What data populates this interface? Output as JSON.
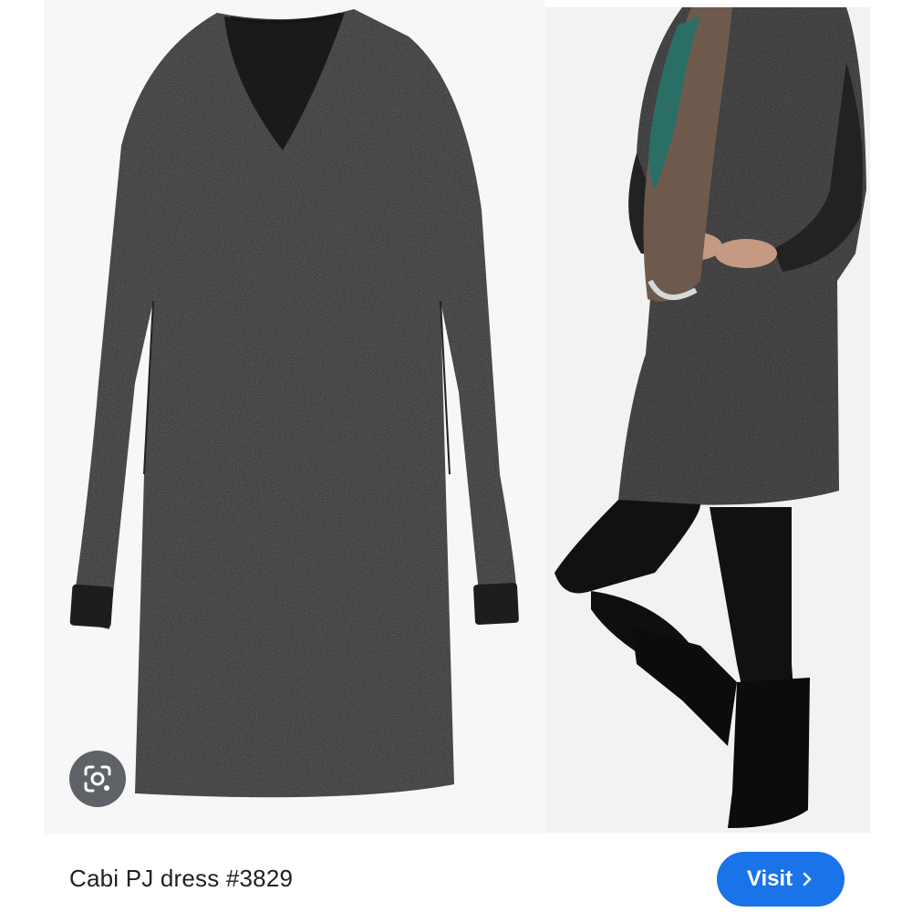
{
  "result": {
    "title": "Cabi PJ dress #3829",
    "visit_label": "Visit"
  },
  "images": {
    "left_alt": "dress-flat-lay",
    "right_alt": "dress-on-model"
  },
  "icons": {
    "lens": "google-lens-icon",
    "chevron": "chevron-right-icon"
  },
  "colors": {
    "accent": "#1a73e8",
    "lens_button": "#5f6368",
    "dress": "#2a2a2a"
  }
}
